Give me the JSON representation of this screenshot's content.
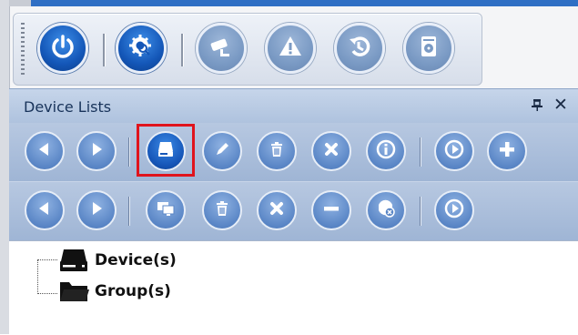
{
  "panel": {
    "title": "Device Lists",
    "pin_glyph": "⍑",
    "close_glyph": "✕"
  },
  "main_toolbar": {
    "buttons": [
      {
        "icon": "power-icon",
        "state": "active"
      },
      {
        "icon": "gear-magnify-icon",
        "state": "active"
      },
      {
        "icon": "camera-icon",
        "state": "disabled"
      },
      {
        "icon": "alert-icon",
        "state": "disabled"
      },
      {
        "icon": "playback-icon",
        "state": "disabled"
      },
      {
        "icon": "disk-icon",
        "state": "disabled"
      }
    ]
  },
  "device_toolbar": {
    "buttons": [
      {
        "icon": "previous-icon",
        "state": "disabled"
      },
      {
        "icon": "next-icon",
        "state": "disabled"
      },
      {
        "icon": "add-device-icon",
        "state": "active",
        "highlighted": true
      },
      {
        "icon": "edit-icon",
        "state": "disabled"
      },
      {
        "icon": "delete-icon",
        "state": "disabled"
      },
      {
        "icon": "remove-icon",
        "state": "disabled"
      },
      {
        "icon": "info-icon",
        "state": "disabled"
      },
      {
        "icon": "play-icon",
        "state": "disabled"
      },
      {
        "icon": "add-icon",
        "state": "disabled"
      }
    ]
  },
  "group_toolbar": {
    "buttons": [
      {
        "icon": "previous-icon",
        "state": "disabled"
      },
      {
        "icon": "next-icon",
        "state": "disabled"
      },
      {
        "icon": "monitors-icon",
        "state": "disabled"
      },
      {
        "icon": "delete-icon",
        "state": "disabled"
      },
      {
        "icon": "remove-icon",
        "state": "disabled"
      },
      {
        "icon": "minus-icon",
        "state": "disabled"
      },
      {
        "icon": "camera-remove-icon",
        "state": "disabled"
      },
      {
        "icon": "play-icon",
        "state": "disabled"
      }
    ]
  },
  "tree": {
    "items": [
      {
        "label": "Device(s)",
        "icon": "device-icon"
      },
      {
        "label": "Group(s)",
        "icon": "folder-icon"
      }
    ]
  },
  "colors": {
    "accent_blue": "#1457b8",
    "disabled_blue": "#7a9ac4",
    "highlight_red": "#e0141d",
    "panel_header": "#b9cbe4"
  }
}
